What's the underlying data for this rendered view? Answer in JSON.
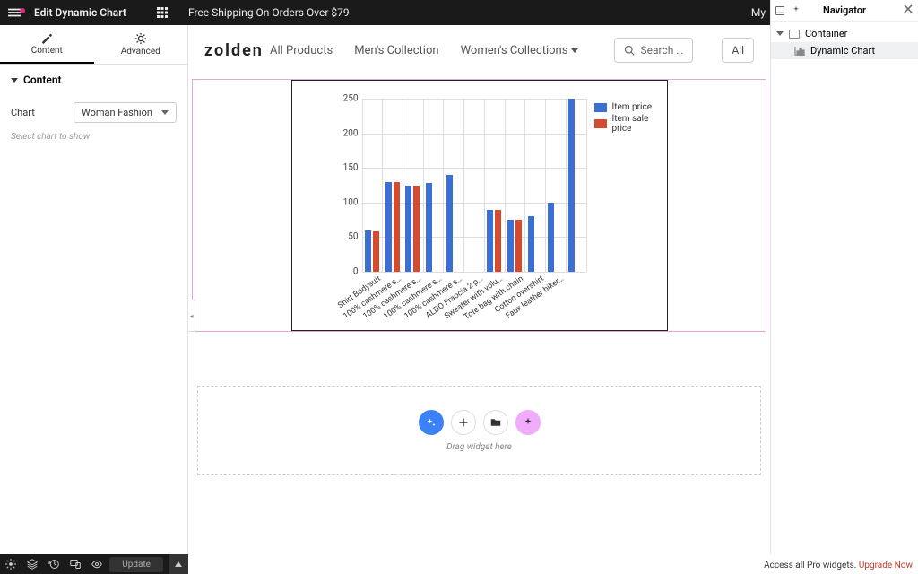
{
  "topbar": {
    "title": "Edit Dynamic Chart",
    "announcement": "Free Shipping On Orders Over $79",
    "right": "My"
  },
  "editor": {
    "tab_content": "Content",
    "tab_advanced": "Advanced",
    "section_header": "Content",
    "chart_label": "Chart",
    "chart_value": "Woman Fashion",
    "hint": "Select chart to show",
    "update_btn": "Update"
  },
  "site": {
    "brand": "zolden",
    "nav_all": "All Products",
    "nav_men": "Men's Collection",
    "nav_women": "Women's Collections",
    "search_placeholder": "Search …",
    "pill_all": "All"
  },
  "drop": {
    "hint": "Drag widget here"
  },
  "navigator": {
    "title": "Navigator",
    "container": "Container",
    "widget": "Dynamic Chart"
  },
  "upgrade": {
    "prefix": "Access all Pro widgets. ",
    "link": "Upgrade Now"
  },
  "chart_data": {
    "type": "bar",
    "ylim": [
      0,
      250
    ],
    "yticks": [
      0,
      50,
      100,
      150,
      200,
      250
    ],
    "categories": [
      "Shirt Bodysuit",
      "100% cashmere s…",
      "100% cashmere s…",
      "100% cashmere s…",
      "100% cashmere s…",
      "ALDO Fraocia 2 p…",
      "Sweater with volu…",
      "Tote bag with chain",
      "Cotton overshirt",
      "Faux leather biker…"
    ],
    "series": [
      {
        "name": "Item price",
        "color": "#3b6fd6",
        "values": [
          60,
          130,
          125,
          128,
          140,
          0,
          90,
          75,
          80,
          100,
          250
        ]
      },
      {
        "name": "Item sale price",
        "color": "#d64a2f",
        "values": [
          58,
          130,
          125,
          0,
          0,
          0,
          90,
          75,
          0,
          0,
          0
        ]
      }
    ]
  }
}
